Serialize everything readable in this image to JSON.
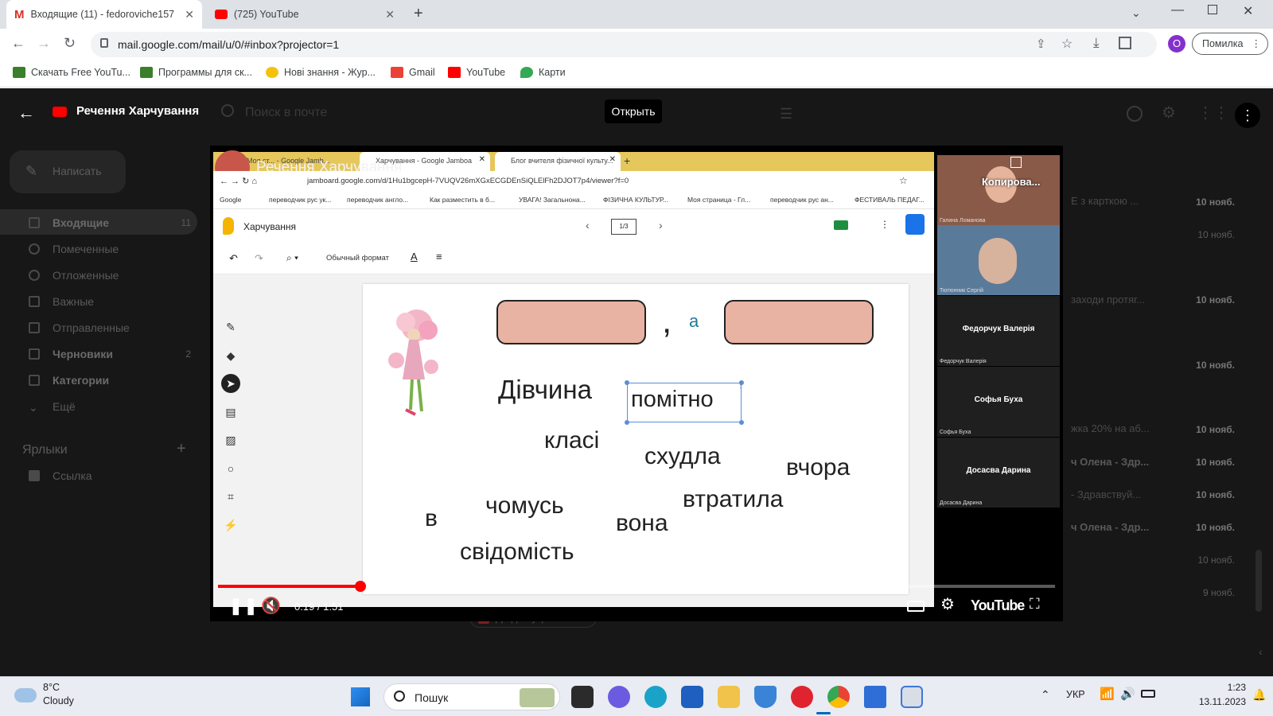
{
  "browser": {
    "tabs": [
      {
        "title": "Входящие (11) - fedoroviche157",
        "icon": "gmail-icon"
      },
      {
        "title": "(725) YouTube",
        "icon": "youtube-icon"
      }
    ],
    "url": "mail.google.com/mail/u/0/#inbox?projector=1",
    "profile_initial": "O",
    "error_label": "Помилка",
    "bookmarks": [
      "Скачать Free YouTu...",
      "Программы для ск...",
      "Нові знання - Жур...",
      "Gmail",
      "YouTube",
      "Карти"
    ]
  },
  "viewer": {
    "title": "Речення Харчування",
    "open_label": "Открыть"
  },
  "gmail": {
    "search_placeholder": "Поиск в почте",
    "compose_label": "Написать",
    "nav": [
      {
        "label": "Входящие",
        "count": "11",
        "bold": true
      },
      {
        "label": "Помеченные"
      },
      {
        "label": "Отложенные"
      },
      {
        "label": "Важные"
      },
      {
        "label": "Отправленные"
      },
      {
        "label": "Черновики",
        "count": "2",
        "bold": true
      },
      {
        "label": "Категории",
        "bold": true
      },
      {
        "label": "Ещё"
      }
    ],
    "labels_heading": "Ярлыки",
    "labels": [
      "Ссылка"
    ],
    "attachment_chip": "До дня укр мов...",
    "mail_snippets": [
      "E з карткою ...",
      "заходи протяг...",
      "жка 20% на аб...",
      "ч Олена - Здр...",
      "- Здравствуй...",
      "ч Олена - Здр..."
    ],
    "dates": [
      "10 нояб.",
      "10 нояб.",
      "10 нояб.",
      "10 нояб.",
      "10 нояб.",
      "10 нояб.",
      "10 нояб.",
      "10 нояб.",
      "10 нояб.",
      "9 нояб."
    ]
  },
  "video": {
    "overlay_title": "Речення Харчування",
    "time": "0:19 / 1:51",
    "progress": 0.17,
    "brand": "YouTube",
    "inner_tabs": [
      "Моя ст... - Google Jamb...",
      "Харчування - Google Jamboa",
      "Блог вчителя фізичної культу..."
    ],
    "inner_url": "jamboard.google.com/d/1Hu1bgcepH-7VUQV26mXGxECGDEnSiQLElFh2DJOT7p4/viewer?f=0",
    "inner_bookmarks": [
      "Google",
      "переводчик рус ук...",
      "переводчик англо...",
      "Как разместить в б...",
      "УВАГА! Загальнона...",
      "ФІЗИЧНА КУЛЬТУР...",
      "Моя страница - Гл...",
      "переводчик рус ан...",
      "ФЕСТИВАЛЬ ПЕДАГ..."
    ],
    "jamboard": {
      "doc_title": "Харчування",
      "page": "1/3",
      "format": "Обычный формат",
      "comma": ",",
      "conj": "а",
      "words": [
        {
          "text": "Дівчина"
        },
        {
          "text": "помітно",
          "selected": true
        },
        {
          "text": "класі"
        },
        {
          "text": "схудла"
        },
        {
          "text": "вчора"
        },
        {
          "text": "втратила"
        },
        {
          "text": "в"
        },
        {
          "text": "чомусь"
        },
        {
          "text": "вона"
        },
        {
          "text": "свідомість"
        }
      ]
    },
    "participants": [
      {
        "name": "Галина Ломанова",
        "overlay": "Копирова..."
      },
      {
        "name": "Тютюнник Сергій"
      },
      {
        "name": "Федорчук Валерія"
      },
      {
        "name": "Софья Буха"
      },
      {
        "name": "Досасва Дарина"
      }
    ]
  },
  "taskbar": {
    "temperature": "8°C",
    "weather": "Cloudy",
    "search_label": "Пошук",
    "language": "УКР",
    "time": "1:23",
    "date": "13.11.2023"
  }
}
